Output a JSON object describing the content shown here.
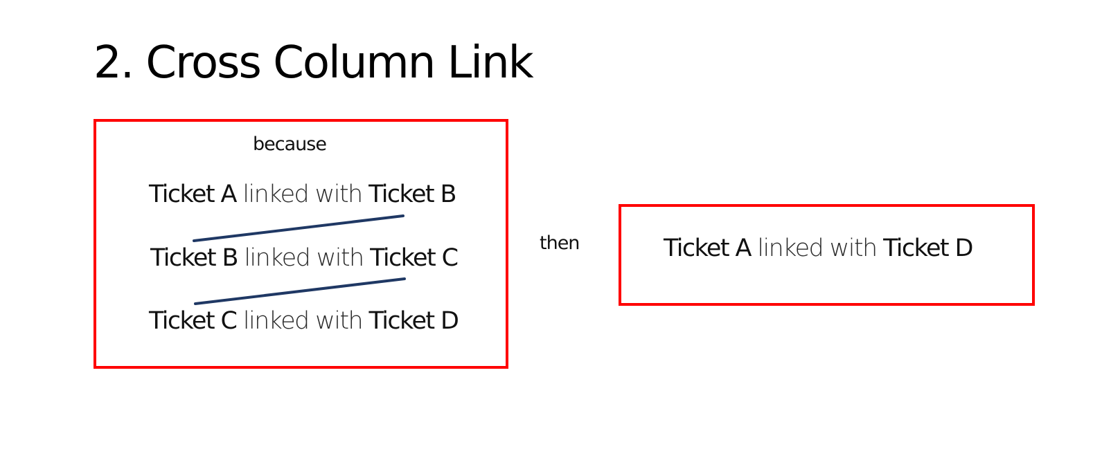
{
  "title": "2. Cross Column Link",
  "condition_label": "because",
  "result_label": "then",
  "links": [
    {
      "from": "Ticket A",
      "connector": " linked with ",
      "to": "Ticket B"
    },
    {
      "from": "Ticket B",
      "connector": " linked with ",
      "to": "Ticket C"
    },
    {
      "from": "Ticket C",
      "connector": " linked with ",
      "to": "Ticket D"
    }
  ],
  "result": {
    "from": "Ticket A",
    "connector": " linked with ",
    "to": "Ticket D"
  },
  "colors": {
    "box_border": "#ff0000",
    "connector_line": "#1f3864",
    "text": "#111111"
  }
}
